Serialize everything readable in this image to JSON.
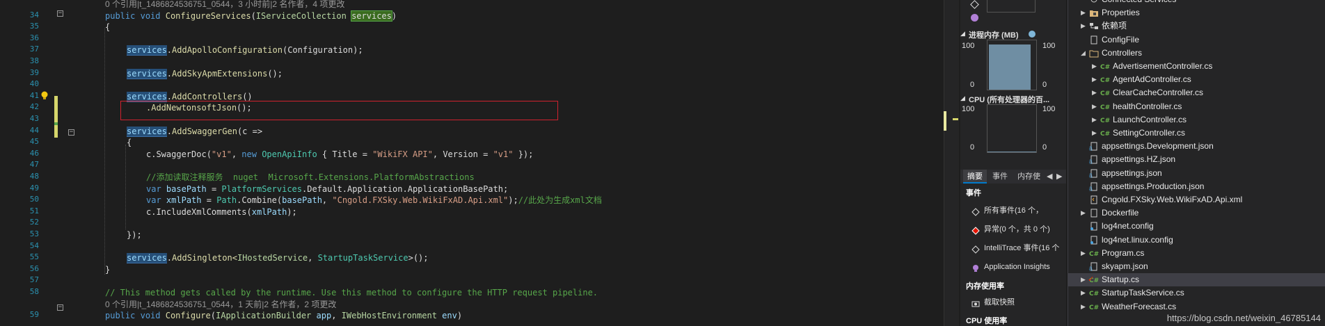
{
  "editor": {
    "lines": [
      {
        "n": "",
        "lens": "0 个引用|t_1486824536751_0544，3 小时前|2 名作者，4 项更改"
      },
      {
        "n": "34"
      },
      {
        "n": "35"
      },
      {
        "n": "36"
      },
      {
        "n": "37"
      },
      {
        "n": "38"
      },
      {
        "n": "39"
      },
      {
        "n": "40"
      },
      {
        "n": "41"
      },
      {
        "n": "42"
      },
      {
        "n": "43"
      },
      {
        "n": "44"
      },
      {
        "n": "45"
      },
      {
        "n": "46"
      },
      {
        "n": "47"
      },
      {
        "n": "48"
      },
      {
        "n": "49"
      },
      {
        "n": "50"
      },
      {
        "n": "51"
      },
      {
        "n": "52"
      },
      {
        "n": "53"
      },
      {
        "n": "54"
      },
      {
        "n": "55"
      },
      {
        "n": "56"
      },
      {
        "n": "57"
      },
      {
        "n": "58"
      },
      {
        "n": "",
        "lens": "0 个引用|t_1486824536751_0544，1 天前|2 名作者，2 项更改"
      },
      {
        "n": "59"
      }
    ],
    "tokens": {
      "public": "public",
      "void": "void",
      "new": "new",
      "var": "var",
      "configure_services": "ConfigureServices",
      "iservice_collection": "IServiceCollection",
      "services": "services",
      "add_apollo": "AddApolloConfiguration",
      "configuration": "(Configuration);",
      "add_skyapm": "AddSkyApmExtensions",
      "empty_call": "();",
      "add_controllers": "AddControllers",
      "paren_open_close": "()",
      "add_newtonsoft": ".AddNewtonsoftJson",
      "add_swagger": "AddSwaggerGen",
      "lambda": "(c =>",
      "c_swaggerdoc": "c.SwaggerDoc(",
      "v1_str": "\"v1\"",
      "comma": ", ",
      "openapiinfo": "OpenApiInfo",
      "title_prefix": " { Title = ",
      "wikifx_api": "\"WikiFX API\"",
      "version_part": ", Version = ",
      "v1_tail": " });",
      "comment_xml": "//添加读取注释服务  nuget  Microsoft.Extensions.PlatformAbstractions",
      "basepath": "basePath",
      "eq": " = ",
      "platform_services": "PlatformServices",
      "default_app": ".Default.Application.ApplicationBasePath;",
      "xmlpath": "xmlPath",
      "path_ty": "Path",
      "combine": ".Combine(",
      "xml_str": "\"Cngold.FXSky.Web.WikiFxAD.Api.xml\"",
      "close_semicolon": ");",
      "comment_gen": "//此处为生成xml文档",
      "include_xml": "c.IncludeXmlComments(",
      "close_paren_semi": ");",
      "brace_close_paren": "});",
      "add_singleton": "AddSingleton<",
      "ihosted_service": "IHostedService",
      "startup_task": "StartupTaskService",
      "singleton_tail": ">();",
      "open_brace": "{",
      "close_brace": "}",
      "paren_close": ")",
      "dot": ".",
      "comment_runtime": "// This method gets called by the runtime. Use this method to configure the HTTP request pipeline.",
      "configure": "Configure",
      "iapp_builder": "IApplicationBuilder",
      "app": "app",
      "iwebhost_env": "IWebHostEnvironment",
      "env": "env"
    }
  },
  "diagnostics": {
    "memory_title": "进程内存 (MB)",
    "memory_axis_max": "100",
    "memory_axis_min": "0",
    "memory_level": 0.92,
    "cpu_title": "CPU (所有处理器的百...",
    "cpu_axis_max": "100",
    "cpu_axis_min": "0",
    "tabs": [
      "摘要",
      "事件",
      "内存使"
    ],
    "events_heading": "事件",
    "events": [
      {
        "label": "所有事件(16 个，",
        "icon": "diamond-icon"
      },
      {
        "label": "异常(0 个，共 0 个)",
        "icon": "red-diamond-icon"
      },
      {
        "label": "IntelliTrace 事件(16 个",
        "icon": "diamond-icon"
      },
      {
        "label": "Application Insights",
        "icon": "bulb-icon"
      }
    ],
    "memory_usage_heading": "内存使用率",
    "snapshot_label": "截取快照",
    "cpu_usage_heading": "CPU 使用率"
  },
  "solution": {
    "items": [
      {
        "label": "Connected Services",
        "indent": 1,
        "arrow": "",
        "icon": "connected-icon"
      },
      {
        "label": "Properties",
        "indent": 1,
        "arrow": "▶",
        "icon": "properties-icon"
      },
      {
        "label": "依赖项",
        "indent": 1,
        "arrow": "▶",
        "icon": "dependencies-icon"
      },
      {
        "label": "ConfigFile",
        "indent": 1,
        "arrow": "",
        "icon": "file-icon"
      },
      {
        "label": "Controllers",
        "indent": 1,
        "arrow": "◢",
        "icon": "folder-icon"
      },
      {
        "label": "AdvertisementController.cs",
        "indent": 2,
        "arrow": "▶",
        "icon": "cs-file-icon"
      },
      {
        "label": "AgentAdController.cs",
        "indent": 2,
        "arrow": "▶",
        "icon": "cs-file-icon"
      },
      {
        "label": "ClearCacheController.cs",
        "indent": 2,
        "arrow": "▶",
        "icon": "cs-file-icon"
      },
      {
        "label": "healthController.cs",
        "indent": 2,
        "arrow": "▶",
        "icon": "cs-file-icon"
      },
      {
        "label": "LaunchController.cs",
        "indent": 2,
        "arrow": "▶",
        "icon": "cs-file-icon"
      },
      {
        "label": "SettingController.cs",
        "indent": 2,
        "arrow": "▶",
        "icon": "cs-file-icon"
      },
      {
        "label": "appsettings.Development.json",
        "indent": 1,
        "arrow": "",
        "icon": "json-file-icon"
      },
      {
        "label": "appsettings.HZ.json",
        "indent": 1,
        "arrow": "",
        "icon": "json-file-icon"
      },
      {
        "label": "appsettings.json",
        "indent": 1,
        "arrow": "",
        "icon": "json-file-icon"
      },
      {
        "label": "appsettings.Production.json",
        "indent": 1,
        "arrow": "",
        "icon": "json-file-icon"
      },
      {
        "label": "Cngold.FXSky.Web.WikiFxAD.Api.xml",
        "indent": 1,
        "arrow": "",
        "icon": "xml-file-icon"
      },
      {
        "label": "Dockerfile",
        "indent": 1,
        "arrow": "▶",
        "icon": "file-icon"
      },
      {
        "label": "log4net.config",
        "indent": 1,
        "arrow": "",
        "icon": "config-file-icon"
      },
      {
        "label": "log4net.linux.config",
        "indent": 1,
        "arrow": "",
        "icon": "config-file-icon"
      },
      {
        "label": "Program.cs",
        "indent": 1,
        "arrow": "▶",
        "icon": "cs-file-icon"
      },
      {
        "label": "skyapm.json",
        "indent": 1,
        "arrow": "",
        "icon": "json-file-icon"
      },
      {
        "label": "Startup.cs",
        "indent": 1,
        "arrow": "▶",
        "icon": "cs-file-icon",
        "selected": true,
        "modified": true
      },
      {
        "label": "StartupTaskService.cs",
        "indent": 1,
        "arrow": "▶",
        "icon": "cs-file-icon"
      },
      {
        "label": "WeatherForecast.cs",
        "indent": 1,
        "arrow": "▶",
        "icon": "cs-file-icon"
      }
    ],
    "watermark": "https://blog.csdn.net/weixin_46785144"
  },
  "colors": {
    "editor_bg": "#1e1e1e",
    "panel_bg": "#252526",
    "highlight_box": "#d0222e",
    "keyword": "#569cd6",
    "type": "#4ec9b0",
    "string": "#d69d85",
    "comment": "#57a64a"
  }
}
